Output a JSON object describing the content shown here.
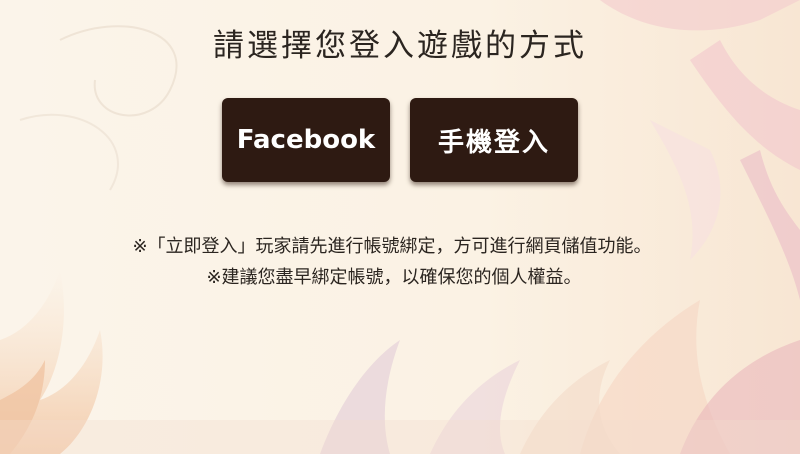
{
  "title": "請選擇您登入遊戲的方式",
  "buttons": {
    "facebook_label": "Facebook",
    "phone_label": "手機登入"
  },
  "notices": [
    "※「立即登入」玩家請先進行帳號綁定，方可進行網頁儲值功能。",
    "※建議您盡早綁定帳號，以確保您的個人權益。"
  ],
  "colors": {
    "button_bg": "#2e1a12",
    "button_text": "#ffffff",
    "text": "#2b2520",
    "background": "#fbf4ea"
  }
}
